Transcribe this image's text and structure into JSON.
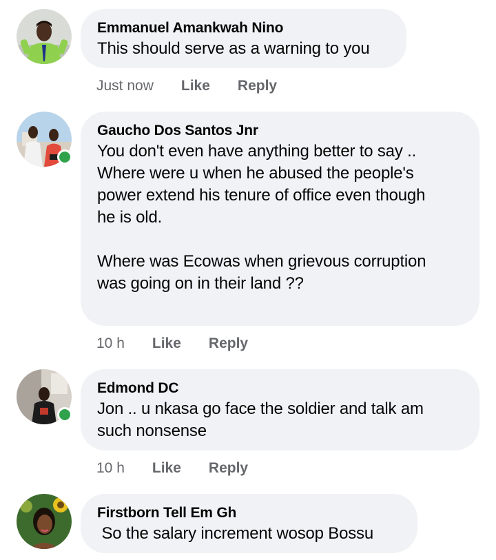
{
  "comments": [
    {
      "author": "Emmanuel Amankwah Nino",
      "text": "This should serve as a warning to you",
      "time": "Just now",
      "like": "Like",
      "reply": "Reply",
      "online": false
    },
    {
      "author": "Gaucho Dos Santos Jnr",
      "text": "You don't even have anything better to say ..\nWhere were u when he abused the people's\npower extend his tenure of office even though\nhe is old.\n\nWhere was Ecowas when grievous corruption\nwas going on in their land ??",
      "time": "10 h",
      "like": "Like",
      "reply": "Reply",
      "online": true
    },
    {
      "author": "Edmond DC",
      "text": "Jon .. u nkasa go face the soldier and talk am\nsuch nonsense",
      "time": "10 h",
      "like": "Like",
      "reply": "Reply",
      "online": true
    },
    {
      "author": "Firstborn Tell Em Gh",
      "text": " So the salary increment wosop Bossu",
      "online": false
    }
  ],
  "colors": {
    "bubble": "#f0f2f5",
    "meta": "#65676b",
    "online": "#31a24c"
  }
}
